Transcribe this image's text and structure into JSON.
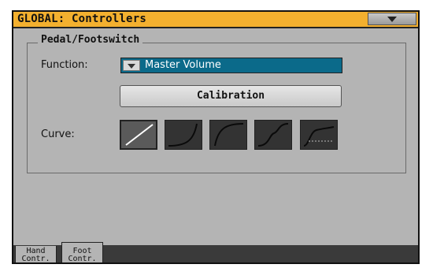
{
  "window": {
    "title": "GLOBAL: Controllers",
    "menu_icon": "chevron-down-icon"
  },
  "group": {
    "title": "Pedal/Footswitch"
  },
  "function": {
    "label": "Function:",
    "value": "Master Volume"
  },
  "calibration": {
    "label": "Calibration"
  },
  "curve": {
    "label": "Curve:",
    "selected_index": 0,
    "options": [
      "linear-curve-icon",
      "exponential-curve-icon",
      "logarithmic-curve-icon",
      "s-curve-icon",
      "switch-curve-icon"
    ]
  },
  "tabs": [
    {
      "line1": "Hand",
      "line2": "Contr.",
      "active": false
    },
    {
      "line1": "Foot",
      "line2": "Contr.",
      "active": true
    }
  ],
  "colors": {
    "title_bar": "#f3b02f",
    "panel": "#b4b4b4",
    "selection": "#0b6a8a"
  }
}
